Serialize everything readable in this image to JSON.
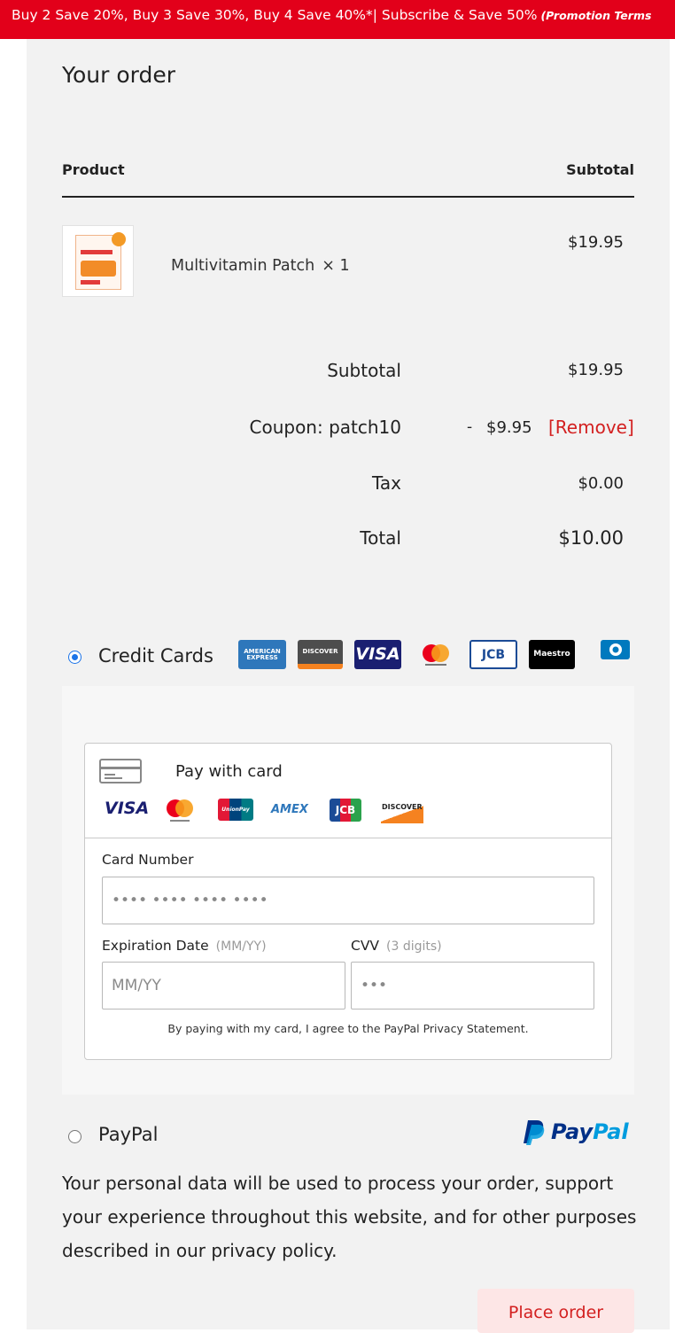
{
  "promo": {
    "text": "Buy 2 Save 20%, Buy 3 Save 30%, Buy 4 Save 40%*| Subscribe & Save 50%",
    "terms": "(Promotion Terms"
  },
  "order": {
    "heading": "Your order",
    "columns": {
      "product": "Product",
      "subtotal": "Subtotal"
    },
    "items": [
      {
        "name": "Multivitamin Patch",
        "quantity": "× 1",
        "price": "$19.95"
      }
    ],
    "summary": {
      "subtotal_label": "Subtotal",
      "subtotal_value": "$19.95",
      "coupon_label": "Coupon: patch10",
      "coupon_minus": "-",
      "coupon_amount": "$9.95",
      "coupon_remove": "[Remove]",
      "tax_label": "Tax",
      "tax_value": "$0.00",
      "total_label": "Total",
      "total_value": "$10.00"
    }
  },
  "payment": {
    "credit_cards_label": "Credit Cards",
    "credit_cards_selected": true,
    "accepted_cards": [
      {
        "name": "American Express",
        "text": "AMERICAN EXPRESS",
        "bg": "#2e77bb"
      },
      {
        "name": "Discover",
        "text": "DISCOVER",
        "bg": "#4d4d4d"
      },
      {
        "name": "Visa",
        "text": "VISA",
        "bg": "#1a1f71"
      },
      {
        "name": "Mastercard",
        "text": "",
        "bg": "#ffffff"
      },
      {
        "name": "JCB",
        "text": "JCB",
        "bg": "#1b4b96"
      },
      {
        "name": "Maestro",
        "text": "Maestro",
        "bg": "#000000"
      },
      {
        "name": "Diners Club",
        "text": "",
        "bg": "#ffffff"
      }
    ],
    "card_form": {
      "pay_with_card": "Pay with card",
      "brands": [
        "VISA",
        "UnionPay",
        "AMEX",
        "JCB",
        "DISCOVER"
      ],
      "card_number_label": "Card Number",
      "card_number_placeholder": "•••• •••• •••• ••••",
      "expiration_label": "Expiration Date",
      "expiration_hint": "(MM/YY)",
      "expiration_placeholder": "MM/YY",
      "cvv_label": "CVV",
      "cvv_hint": "(3 digits)",
      "cvv_placeholder": "•••",
      "agreement": "By paying with my card, I agree to the PayPal Privacy Statement."
    },
    "paypal_label": "PayPal",
    "paypal_selected": false,
    "paypal_logo": {
      "pay": "Pay",
      "pal": "Pal"
    }
  },
  "privacy_notice": "Your personal data will be used to process your order, support your experience throughout this website, and for other purposes described in our privacy policy.",
  "place_order_label": "Place order",
  "colors": {
    "promo_red": "#e2001a",
    "panel_gray": "#f2f2f2",
    "remove_red": "#d32020",
    "radio_blue": "#1a73e8",
    "paypal_navy": "#003087",
    "paypal_light": "#009cde"
  }
}
